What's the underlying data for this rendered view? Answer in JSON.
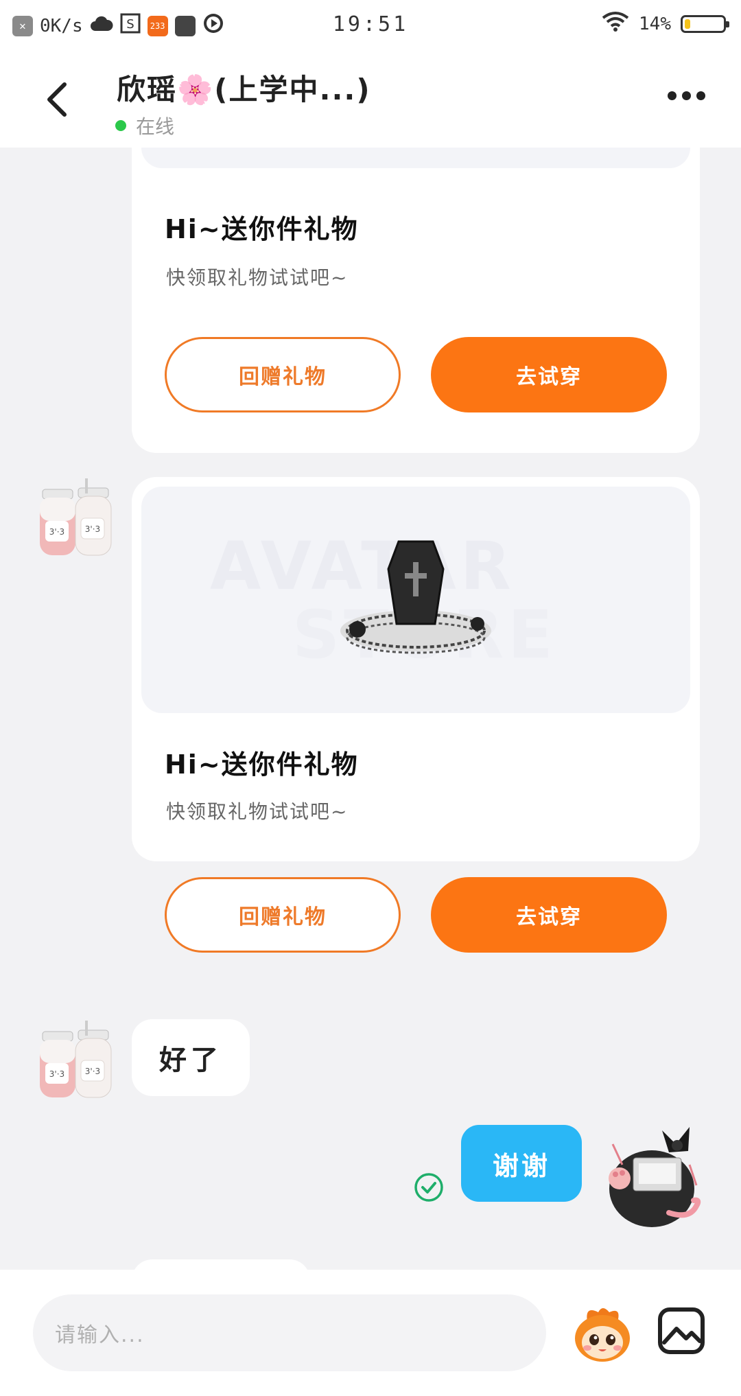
{
  "status_bar": {
    "network_speed": "0K/s",
    "app_icon_233": "233",
    "time": "19:51",
    "battery_percent": "14%",
    "battery_level": 0.14,
    "icons": [
      "close-badge-icon",
      "cloud-icon",
      "s-box-icon",
      "app-233-icon",
      "square-icon",
      "play-circle-icon",
      "wifi-icon",
      "battery-icon"
    ]
  },
  "header": {
    "contact_name": "欣瑶🌸(上学中...)",
    "online_status": "在线",
    "status_color": "#2bc84a"
  },
  "messages": {
    "gift_card_1": {
      "title": "Hi~送你件礼物",
      "subtitle": "快领取礼物试试吧~",
      "return_gift_label": "回赠礼物",
      "try_on_label": "去试穿"
    },
    "gift_card_2": {
      "watermark_top": "AVATAR",
      "watermark_bottom": "STORE",
      "title": "Hi~送你件礼物",
      "subtitle": "快领取礼物试试吧~",
      "return_gift_label": "回赠礼物",
      "try_on_label": "去试穿"
    },
    "received_text": "好了",
    "sent_text": "谢谢"
  },
  "input_bar": {
    "placeholder": "请输入..."
  },
  "colors": {
    "accent_orange": "#fc7513",
    "sent_bubble": "#2ab7f6",
    "read_check": "#1fae6a"
  }
}
